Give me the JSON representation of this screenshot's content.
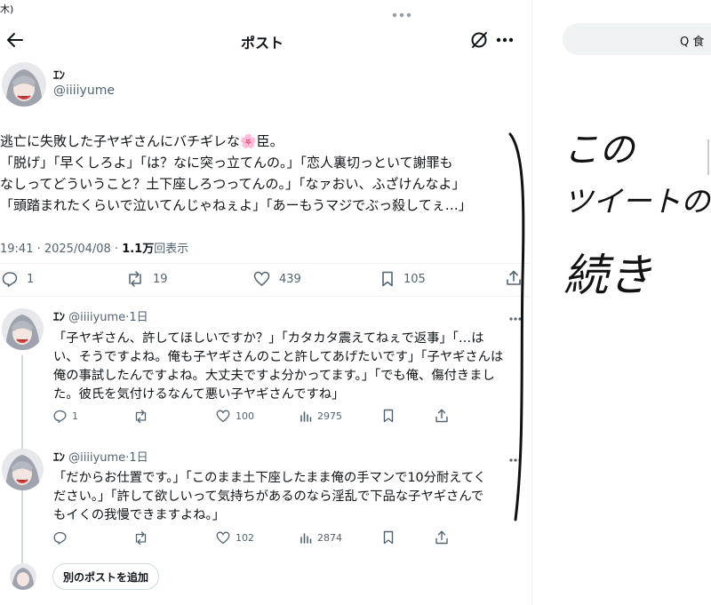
{
  "status": {
    "time_fragment": "木)"
  },
  "header": {
    "title": "ポスト"
  },
  "author": {
    "name": "ｴﾝ",
    "handle": "@iiiiyume"
  },
  "post": {
    "lines": [
      "逃亡に失敗した子ヤギさんにバチギレな🌸臣。",
      "「脱げ」「早くしろよ」「は？なに突っ立てんの。」「恋人裏切っといて謝罪も",
      "なしってどういうこと？土下座しろつってんの。」「なァおい、ふざけんなよ」",
      "「頭踏まれたくらいで泣いてんじゃねぇよ」「あーもうマジでぶっ殺してぇ…」"
    ],
    "time": "19:41 · 2025/04/08 · ",
    "views_count": "1.1万",
    "views_label": "回表示",
    "stats": {
      "replies": "1",
      "reposts": "19",
      "likes": "439",
      "bookmarks": "105"
    }
  },
  "replies": [
    {
      "name": "ｴﾝ",
      "handle": "@iiiiyume",
      "age": "·1日",
      "lines": [
        "「子ヤギさん、許してほしいですか？」「カタカタ震えてねぇで返事」「…は",
        "い、そうですよね。俺も子ヤギさんのこと許してあげたいです」「子ヤギさんは",
        "俺の事試したんですよね。大丈夫ですよ分かってます。」「でも俺、傷付きまし",
        "た。彼氏を気付けるなんて悪い子ヤギさんですね」"
      ],
      "stats": {
        "replies": "1",
        "reposts": "",
        "likes": "100",
        "views": "2975"
      }
    },
    {
      "name": "ｴﾝ",
      "handle": "@iiiiyume",
      "age": "·1日",
      "lines": [
        "「だからお仕置です。」「このまま土下座したまま俺の手マンで10分耐えてく",
        "ださい。」「許して欲しいって気持ちがあるのなら淫乱で下品な子ヤギさんで",
        "もイくの我慢できますよね。」"
      ],
      "stats": {
        "replies": "",
        "reposts": "",
        "likes": "102",
        "views": "2874"
      }
    }
  ],
  "compose": {
    "add_post_label": "別のポストを追加"
  },
  "side": {
    "search_fragment": "Q 食"
  },
  "annotation": {
    "lines": [
      "この",
      "ツイートの",
      "続き"
    ]
  },
  "colors": {
    "primary_text": "#0f1419",
    "secondary_text": "#536471",
    "divider": "#eff3f4"
  }
}
